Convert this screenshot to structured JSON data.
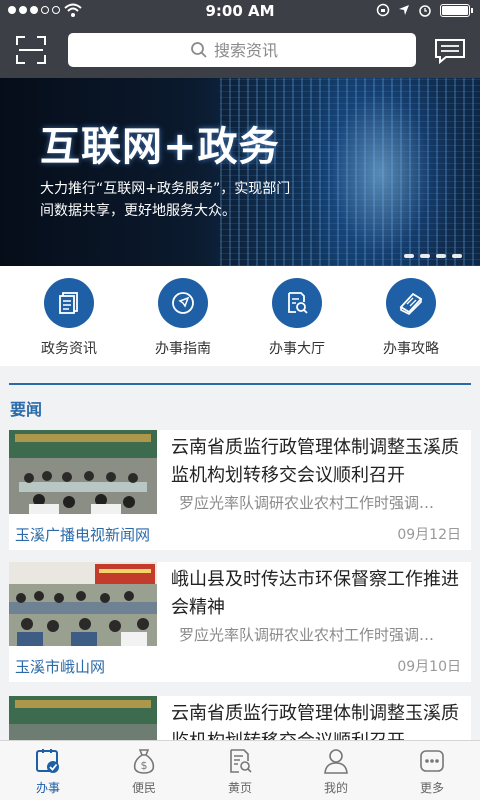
{
  "status_bar": {
    "time": "9:00 AM"
  },
  "header": {
    "search_placeholder": "搜索资讯"
  },
  "banner": {
    "title": "互联网+政务",
    "subtitle": "大力推行“互联网+政务服务”，实现部门间数据共享，更好地服务大众。",
    "slide_count": 4,
    "active_slide": 1
  },
  "quick_nav": [
    {
      "label": "政务资讯",
      "icon": "document-icon"
    },
    {
      "label": "办事指南",
      "icon": "compass-icon"
    },
    {
      "label": "办事大厅",
      "icon": "search-document-icon"
    },
    {
      "label": "办事攻略",
      "icon": "book-icon"
    }
  ],
  "news": {
    "section_title": "要闻",
    "items": [
      {
        "title": "云南省质监行政管理体制调整玉溪质监机构划转移交会议顺利召开",
        "summary": "罗应光率队调研农业农村工作时强调…",
        "source": "玉溪广播电视新闻网",
        "date": "09月12日"
      },
      {
        "title": "峨山县及时传达市环保督察工作推进会精神",
        "summary": "罗应光率队调研农业农村工作时强调…",
        "source": "玉溪市峨山网",
        "date": "09月10日"
      },
      {
        "title": "云南省质监行政管理体制调整玉溪质监机构划转移交会议顺利召开",
        "summary": "",
        "source": "",
        "date": ""
      }
    ]
  },
  "tab_bar": [
    {
      "label": "办事",
      "icon": "checklist-icon",
      "active": true
    },
    {
      "label": "便民",
      "icon": "money-bag-icon",
      "active": false
    },
    {
      "label": "黄页",
      "icon": "directory-icon",
      "active": false
    },
    {
      "label": "我的",
      "icon": "user-icon",
      "active": false
    },
    {
      "label": "更多",
      "icon": "more-icon",
      "active": false
    }
  ],
  "colors": {
    "header_bg": "#3c3f46",
    "accent": "#1e5fa6",
    "link": "#2b6aa8"
  }
}
